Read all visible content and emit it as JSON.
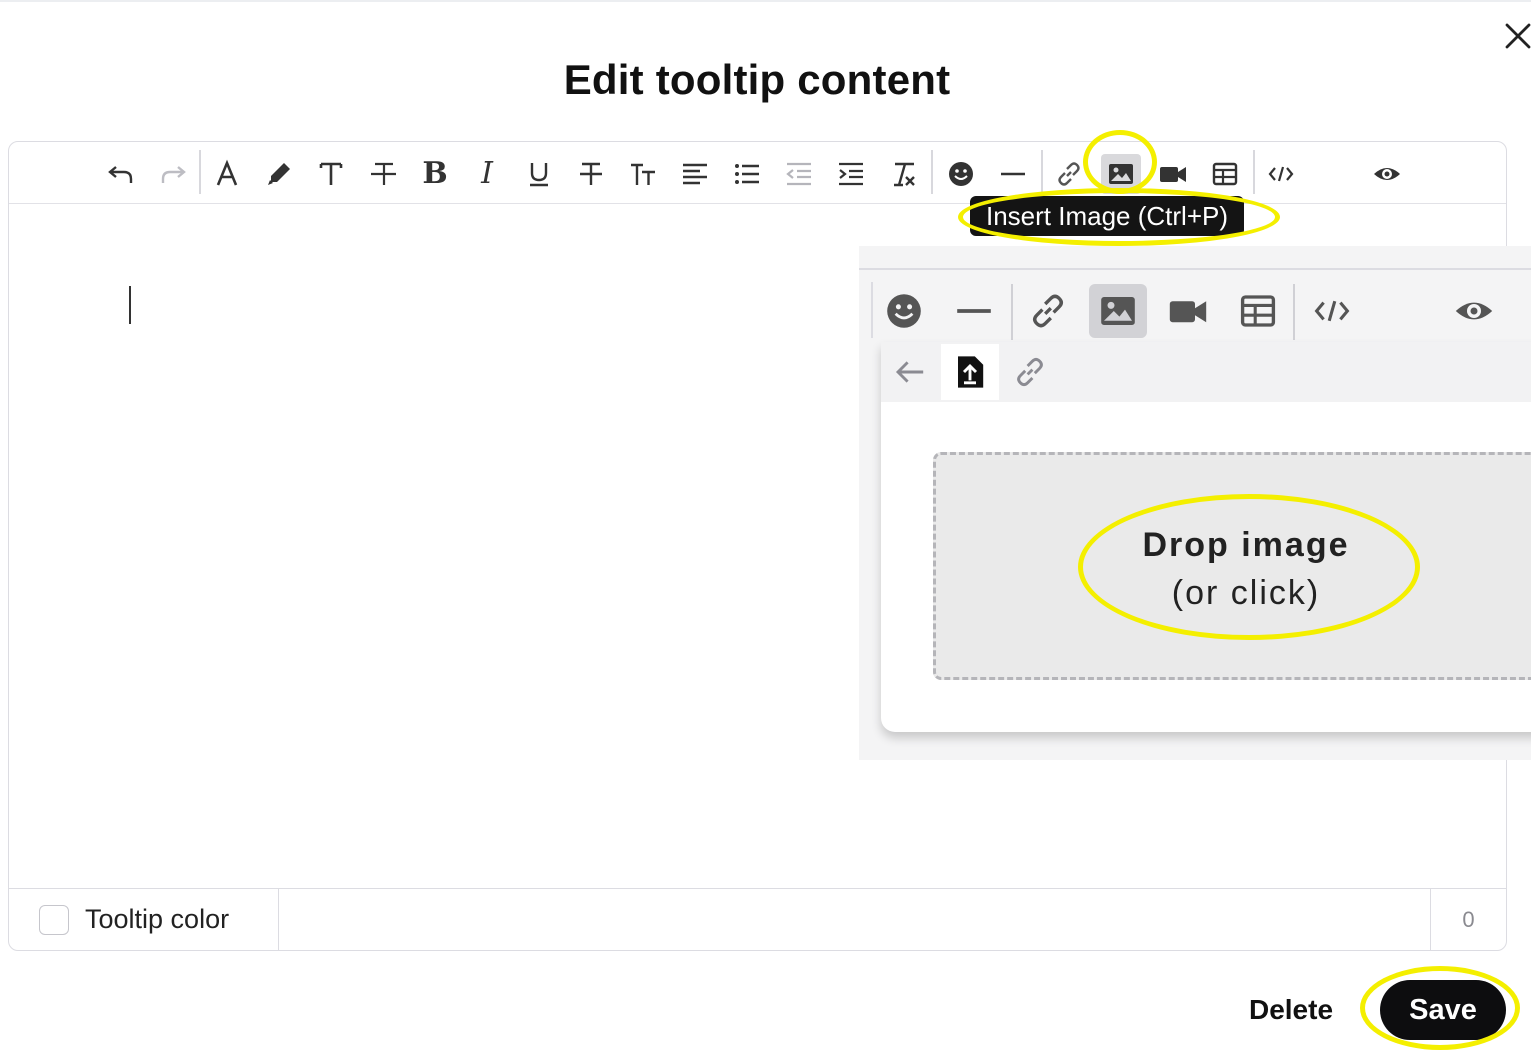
{
  "dialog": {
    "title": "Edit tooltip content"
  },
  "toolbar": {
    "items": [
      "undo-icon",
      "redo-icon",
      "font-color-icon",
      "highlight-icon",
      "text-size-icon",
      "line-height-icon",
      "bold-icon",
      "italic-icon",
      "underline-icon",
      "strikethrough-icon",
      "small-caps-icon",
      "align-left-icon",
      "bullet-list-icon",
      "outdent-icon",
      "indent-icon",
      "clear-format-icon",
      "emoji-icon",
      "horizontal-rule-icon",
      "link-icon",
      "image-icon",
      "video-icon",
      "table-icon",
      "code-view-icon",
      "preview-icon"
    ],
    "active_item": "image-icon"
  },
  "tooltip": {
    "text": "Insert Image (Ctrl+P)"
  },
  "image_popup": {
    "tabs": [
      "back-arrow-icon",
      "upload-icon",
      "link-icon"
    ],
    "active_tab": "upload-icon",
    "drop_title": "Drop image",
    "drop_sub": "(or click)"
  },
  "footer": {
    "checkbox_label": "Tooltip color",
    "checkbox_checked": false,
    "char_count": "0"
  },
  "actions": {
    "delete_label": "Delete",
    "save_label": "Save"
  },
  "colors": {
    "highlight": "#f4ef00",
    "primary_button": "#0d0d0f",
    "tooltip_bg": "#141414",
    "active_button": "#d9d9dc"
  }
}
